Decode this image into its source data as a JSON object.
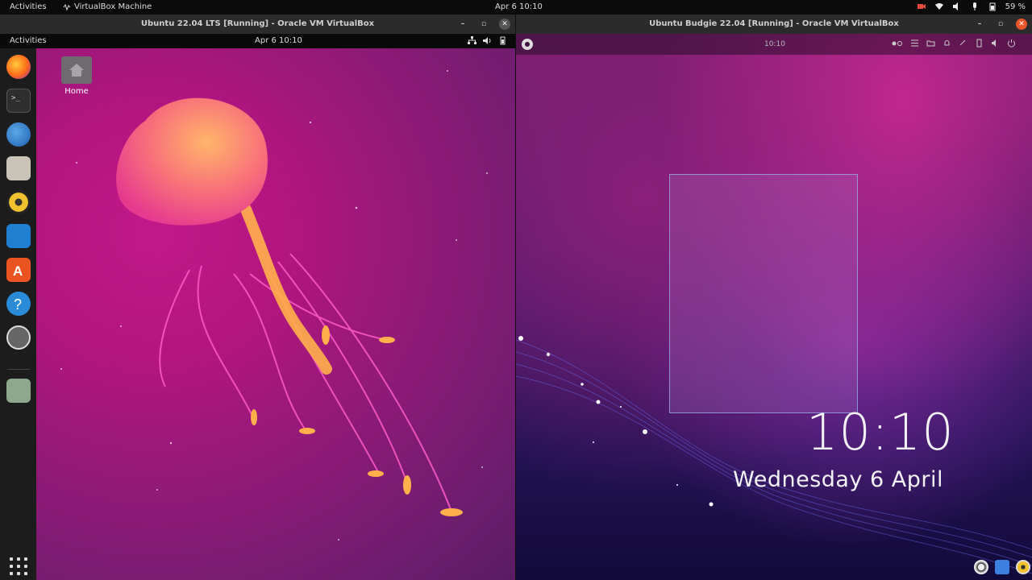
{
  "host": {
    "activities": "Activities",
    "app_name": "VirtualBox Machine",
    "clock": "Apr 6  10:10",
    "battery": "59 %"
  },
  "left_window": {
    "title": "Ubuntu 22.04 LTS [Running] - Oracle VM VirtualBox",
    "guest_activities": "Activities",
    "guest_clock": "Apr 6  10:10",
    "desktop_icon_label": "Home",
    "dock_items": [
      "Firefox",
      "Terminal",
      "Thunderbird",
      "Files",
      "Rhythmbox",
      "LibreOffice Writer",
      "Ubuntu Software",
      "Help",
      "Software Updater",
      "Trash"
    ]
  },
  "right_window": {
    "title": "Ubuntu Budgie 22.04 [Running] - Oracle VM VirtualBox",
    "panel_clock": "10:10",
    "lock_time": "10:10",
    "lock_date": "Wednesday  6 April"
  },
  "colors": {
    "ubuntu_orange": "#e95420",
    "host_bar": "#0b0b0b",
    "titlebar": "#2b2b2b"
  }
}
